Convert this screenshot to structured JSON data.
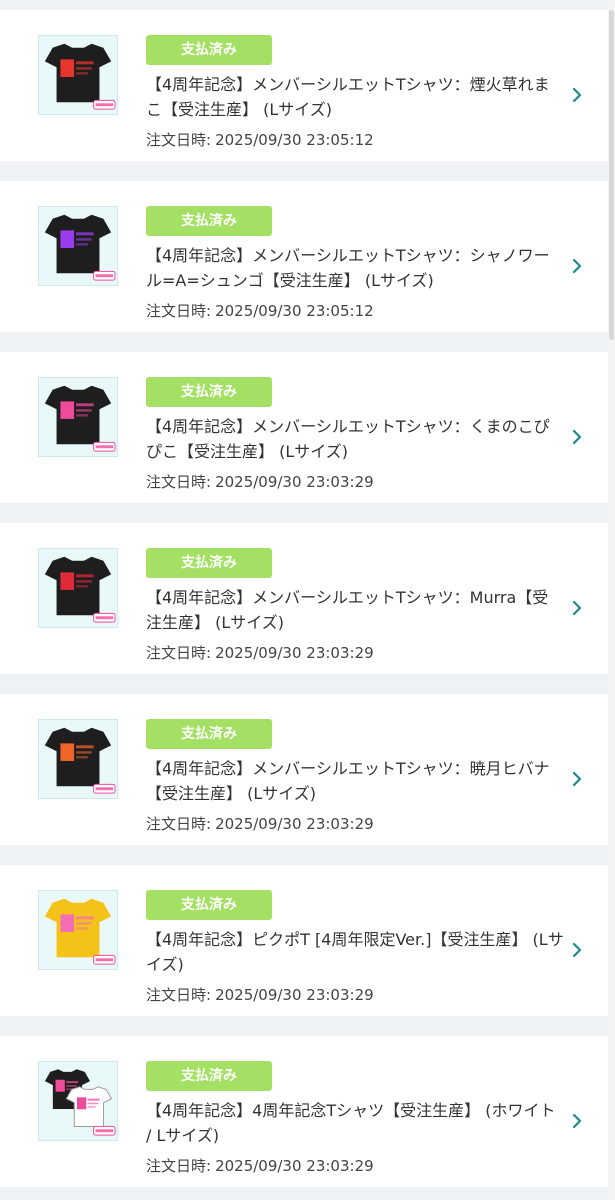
{
  "orders": [
    {
      "status": "支払済み",
      "title": "【4周年記念】メンバーシルエットTシャツ：煙火草れまこ【受注生産】 (Lサイズ)",
      "date_label": "注文日時:",
      "date": "2025/09/30 23:05:12",
      "thumbnail": "black-tshirt-icon",
      "shirt_color": "#1e1e1e",
      "print_color": "#e8352e"
    },
    {
      "status": "支払済み",
      "title": "【4周年記念】メンバーシルエットTシャツ：シャノワール=A=シュンゴ【受注生産】 (Lサイズ)",
      "date_label": "注文日時:",
      "date": "2025/09/30 23:05:12",
      "thumbnail": "black-tshirt-icon",
      "shirt_color": "#1e1e1e",
      "print_color": "#9b3cf0"
    },
    {
      "status": "支払済み",
      "title": "【4周年記念】メンバーシルエットTシャツ：くまのこぴぴこ【受注生産】 (Lサイズ)",
      "date_label": "注文日時:",
      "date": "2025/09/30 23:03:29",
      "thumbnail": "black-tshirt-icon",
      "shirt_color": "#1e1e1e",
      "print_color": "#f04a9a"
    },
    {
      "status": "支払済み",
      "title": "【4周年記念】メンバーシルエットTシャツ：Murra【受注生産】 (Lサイズ)",
      "date_label": "注文日時:",
      "date": "2025/09/30 23:03:29",
      "thumbnail": "black-tshirt-icon",
      "shirt_color": "#1e1e1e",
      "print_color": "#e02a3a"
    },
    {
      "status": "支払済み",
      "title": "【4周年記念】メンバーシルエットTシャツ：暁月ヒバナ【受注生産】 (Lサイズ)",
      "date_label": "注文日時:",
      "date": "2025/09/30 23:03:29",
      "thumbnail": "black-tshirt-icon",
      "shirt_color": "#1e1e1e",
      "print_color": "#f0642a"
    },
    {
      "status": "支払済み",
      "title": "【4周年記念】ピクポT [4周年限定Ver.]【受注生産】 (Lサイズ)",
      "date_label": "注文日時:",
      "date": "2025/09/30 23:03:29",
      "thumbnail": "yellow-tshirt-icon",
      "shirt_color": "#f5c21a",
      "print_color": "#f26fb5"
    },
    {
      "status": "支払済み",
      "title": "【4周年記念】4周年記念Tシャツ【受注生産】 (ホワイト / Lサイズ)",
      "date_label": "注文日時:",
      "date": "2025/09/30 23:03:29",
      "thumbnail": "two-tshirts-icon",
      "shirt_color": "#1e1e1e",
      "print_color": "#f04a9a"
    }
  ],
  "colors": {
    "badge": "#a3e064",
    "chevron": "#1f8a8a",
    "background": "#eef2f5",
    "card": "#ffffff"
  }
}
